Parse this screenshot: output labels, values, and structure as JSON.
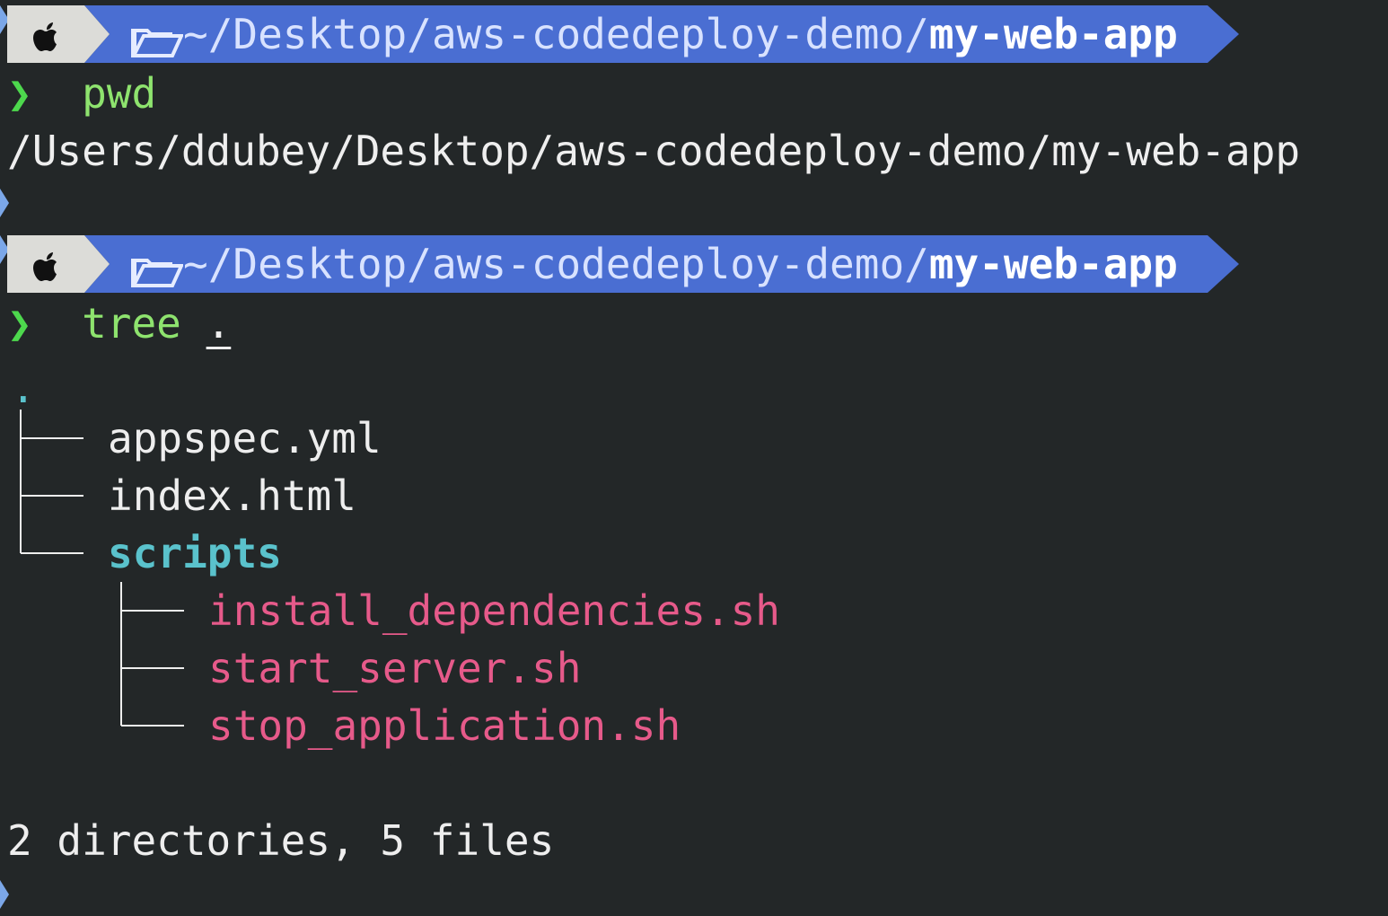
{
  "colors": {
    "background": "#232728",
    "prompt_bar": "#4a6ed2",
    "os_segment": "#dcdcd8",
    "arrow": "#4dd84d",
    "command": "#8ee36e",
    "directory": "#5ac2cc",
    "executable": "#e65a8a",
    "text": "#eeeeee"
  },
  "prompts": [
    {
      "os_icon": "apple-icon",
      "folder_icon": "folder-open-icon",
      "path_prefix": "~/Desktop/aws-codedeploy-demo/",
      "path_current": "my-web-app"
    },
    {
      "os_icon": "apple-icon",
      "folder_icon": "folder-open-icon",
      "path_prefix": "~/Desktop/aws-codedeploy-demo/",
      "path_current": "my-web-app"
    }
  ],
  "prompt_symbol": "❯",
  "commands": [
    {
      "name": "pwd",
      "arg": ""
    },
    {
      "name": "tree",
      "arg": "."
    }
  ],
  "pwd_output": "/Users/ddubey/Desktop/aws-codedeploy-demo/my-web-app",
  "tree": {
    "root": ".",
    "entries": [
      {
        "name": "appspec.yml",
        "type": "file"
      },
      {
        "name": "index.html",
        "type": "file"
      },
      {
        "name": "scripts",
        "type": "directory",
        "children": [
          {
            "name": "install_dependencies.sh",
            "type": "executable"
          },
          {
            "name": "start_server.sh",
            "type": "executable"
          },
          {
            "name": "stop_application.sh",
            "type": "executable"
          }
        ]
      }
    ],
    "summary": "2 directories, 5 files"
  }
}
